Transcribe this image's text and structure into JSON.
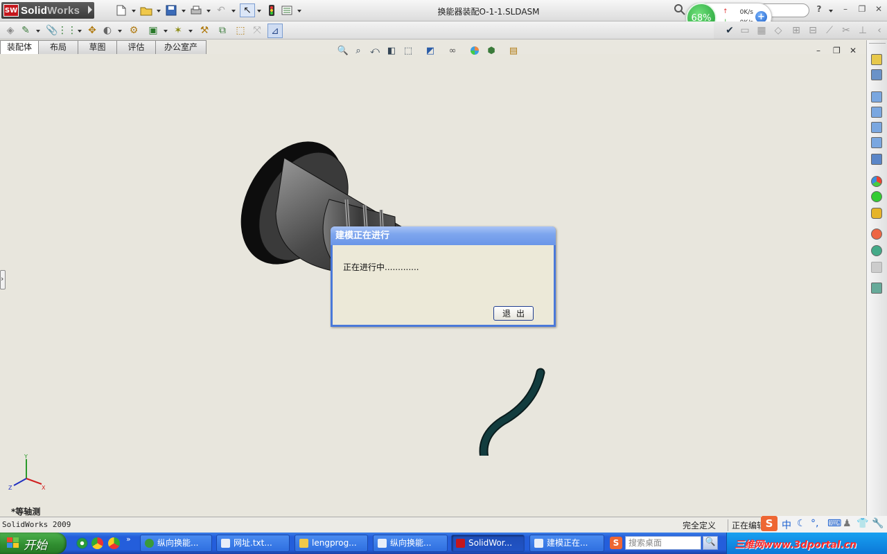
{
  "app": {
    "logo_abbr": "SW",
    "logo_name_a": "Solid",
    "logo_name_b": "Works",
    "document_title": "换能器装配O-1-1.SLDASM"
  },
  "network_widget": {
    "percent": "68%",
    "upload": "0K/s",
    "download": "0K/s",
    "up_arrow": "↑",
    "down_arrow": "↓",
    "plus": "+"
  },
  "help_icon": "?",
  "tabs": [
    "装配体",
    "布局",
    "草图",
    "评估",
    "办公室产品"
  ],
  "active_tab": 0,
  "view_label": "*等轴测",
  "triad": {
    "x": "X",
    "y": "Y",
    "z": "Z"
  },
  "dialog": {
    "title": "建模正在进行",
    "message": "正在进行中.............",
    "exit_label": "退出"
  },
  "statusbar": {
    "app_version": "SolidWorks 2009",
    "definition": "完全定义",
    "editing": "正在编辑"
  },
  "taskbar": {
    "start_label": "开始",
    "quick_more": "»",
    "tasks": [
      "纵向换能...",
      "网址.txt...",
      "lengprog...",
      "纵向换能...",
      "SolidWor...",
      "建模正在..."
    ],
    "active_task": 4,
    "search_placeholder": "搜索桌面",
    "ime_cn": "中"
  },
  "watermark": "三维网www.3dportal.cn",
  "colors": {
    "viewport_bg": "#e8e6dd",
    "dialog_title": "#7ea6ee",
    "taskbar": "#245edb",
    "start_green": "#2f8c2f",
    "cable": "#123c3e"
  }
}
